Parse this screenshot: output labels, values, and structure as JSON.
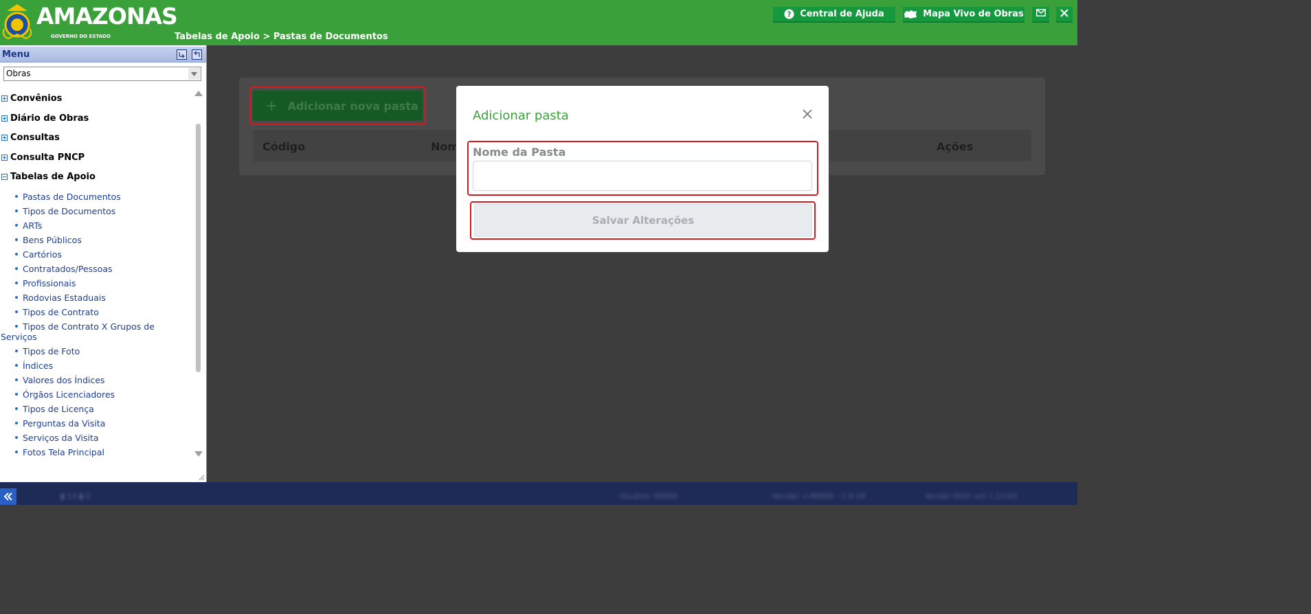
{
  "header": {
    "logo_title": "AMAZONAS",
    "logo_subtitle": "GOVERNO DO ESTADO",
    "breadcrumb": "Tabelas de Apoio > Pastas de Documentos",
    "help_button": "Central de Ajuda",
    "map_button": "Mapa Vivo de Obras",
    "colors": {
      "header_bg": "#3aa13a",
      "button_bg": "#16993e"
    }
  },
  "sidebar": {
    "menu_title": "Menu",
    "select_value": "Obras",
    "groups": [
      {
        "label": "Convênios",
        "expanded": false
      },
      {
        "label": "Diário de Obras",
        "expanded": false
      },
      {
        "label": "Consultas",
        "expanded": false
      },
      {
        "label": "Consulta PNCP",
        "expanded": false
      },
      {
        "label": "Tabelas de Apoio",
        "expanded": true
      }
    ],
    "items": [
      "Pastas de Documentos",
      "Tipos de Documentos",
      "ARTs",
      "Bens Públicos",
      "Cartórios",
      "Contratados/Pessoas",
      "Profissionais",
      "Rodovias Estaduais",
      "Tipos de Contrato",
      "Tipos de Contrato X Grupos de Serviços",
      "Tipos de Foto",
      "Índices",
      "Valores dos Índices",
      "Órgãos Licenciadores",
      "Tipos de Licença",
      "Perguntas da Visita",
      "Serviços da Visita",
      "Fotos Tela Principal"
    ]
  },
  "main": {
    "add_button": "Adicionar nova pasta",
    "table_headers": [
      "Código",
      "Nome",
      "Ações"
    ]
  },
  "modal": {
    "title": "Adicionar pasta",
    "field_label": "Nome da Pasta",
    "field_value": "",
    "save_button": "Salvar Alterações"
  },
  "footer": {
    "info_1": "Usuário: 50000",
    "info_2": "Versão: v-98000 - 1.9.19",
    "info_3": "Versão SGO: uni 1.13.63"
  }
}
